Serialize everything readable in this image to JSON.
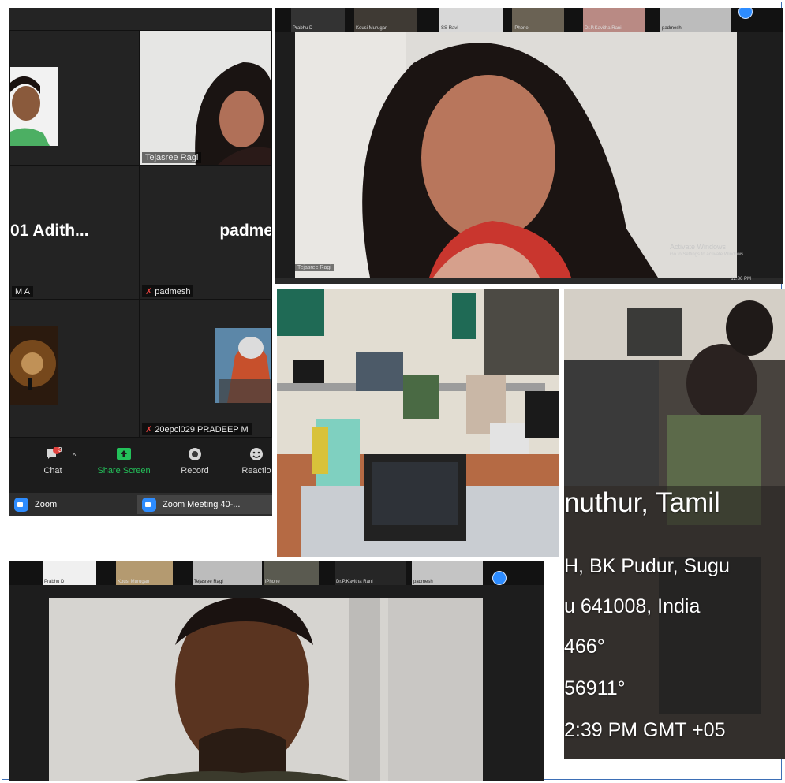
{
  "gallery": {
    "tiles": [
      {
        "name": ""
      },
      {
        "name": "Tejasree Ragi"
      },
      {
        "big_text": "01  Adith...",
        "name": "M A"
      },
      {
        "big_text": "padme",
        "name": "padmesh"
      },
      {
        "name": ""
      },
      {
        "name": "20epci029 PRADEEP M"
      }
    ],
    "toolbar": {
      "chat_label": "Chat",
      "chat_badge": "3",
      "share_label": "Share Screen",
      "record_label": "Record",
      "reactions_label": "Reactio"
    },
    "taskbar": {
      "zoom_label": "Zoom",
      "meeting_label": "Zoom Meeting 40-..."
    }
  },
  "speaker1": {
    "strip_names": [
      "Prabhu D",
      "Kousi Murugan",
      "SS Ravi",
      "iPhone",
      "Dr.P.Kavitha Rani",
      "padmesh"
    ],
    "self_label": "Tejasree Ragi",
    "activate_line1": "Activate Windows",
    "activate_line2": "Go to Settings to activate Windows.",
    "clock": "12:36 PM"
  },
  "speaker2": {
    "strip_names": [
      "Prabhu D",
      "Kousi Murugan",
      "Tejasree Ragi",
      "iPhone",
      "Dr.P.Kavitha Rani",
      "padmesh"
    ]
  },
  "geotag": {
    "line1": "nuthur, Tamil",
    "line2": "H, BK Pudur, Sugu",
    "line3": "u 641008, India",
    "line4": "466°",
    "line5": "56911°",
    "line6": "2:39 PM GMT +05"
  }
}
